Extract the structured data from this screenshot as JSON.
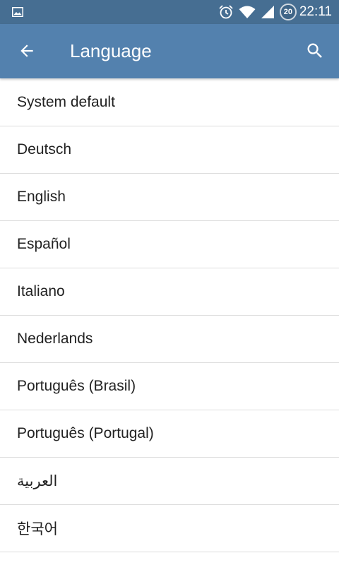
{
  "status_bar": {
    "left_icon": "image-icon",
    "icons": [
      "alarm-icon",
      "wifi-icon",
      "signal-icon"
    ],
    "battery_level": "20",
    "time": "22:11"
  },
  "app_bar": {
    "title": "Language",
    "back_icon": "arrow-back-icon",
    "search_icon": "search-icon",
    "color": "#5381ae"
  },
  "languages": [
    "System default",
    "Deutsch",
    "English",
    "Español",
    "Italiano",
    "Nederlands",
    "Português (Brasil)",
    "Português (Portugal)",
    "العربية",
    "한국어"
  ]
}
